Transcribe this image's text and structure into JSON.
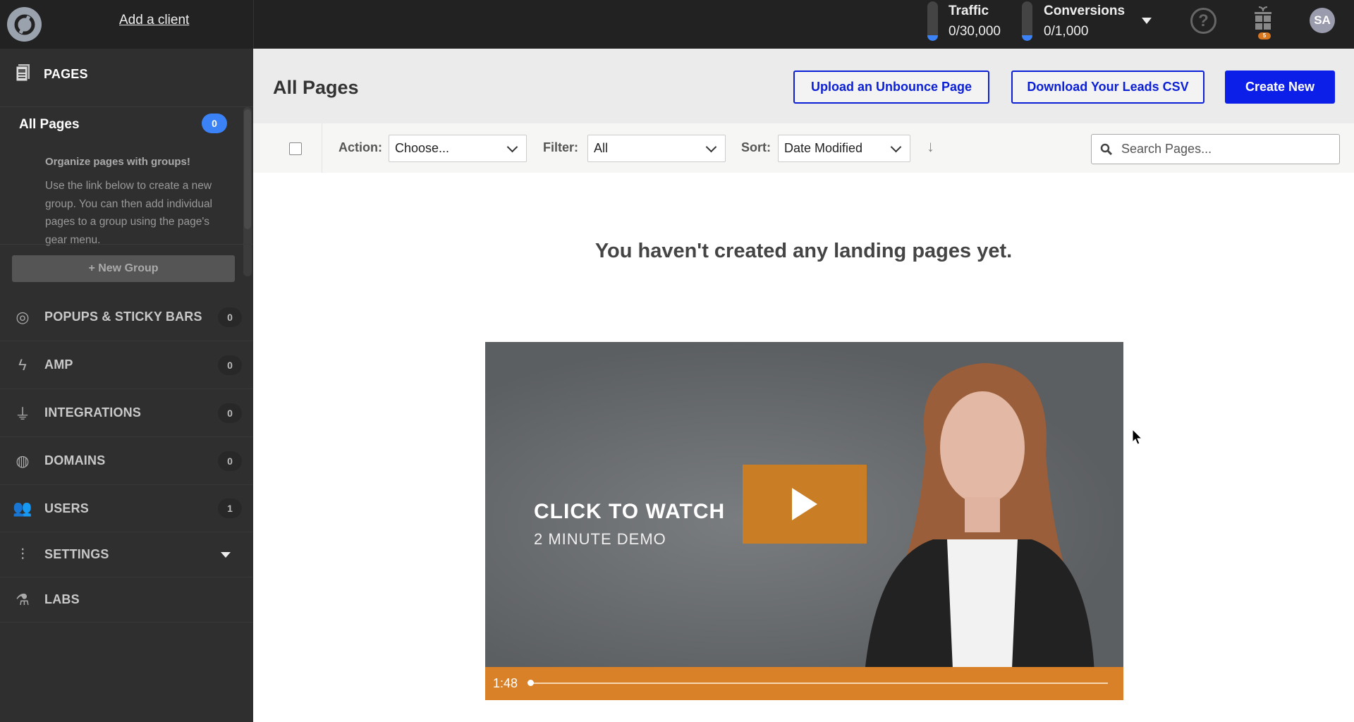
{
  "topbar": {
    "add_client": "Add a client",
    "traffic_label": "Traffic",
    "traffic_value": "0/30,000",
    "traffic_level": 0,
    "conversions_label": "Conversions",
    "conversions_value": "0/1,000",
    "conversions_level": 0,
    "help_glyph": "?",
    "gift_badge": "5",
    "avatar": "SA"
  },
  "sidebar": {
    "pages_label": "PAGES",
    "all_pages": "All Pages",
    "all_pages_count": "0",
    "org_title": "Organize pages with groups!",
    "org_text": "Use the link below to create a new group. You can then add individual pages to a group using the page's gear menu.",
    "new_group": "+ New Group",
    "items": [
      {
        "label": "POPUPS & STICKY BARS",
        "count": "0",
        "icon": "target-icon"
      },
      {
        "label": "AMP",
        "count": "0",
        "icon": "lightning-icon"
      },
      {
        "label": "INTEGRATIONS",
        "count": "0",
        "icon": "plug-icon"
      },
      {
        "label": "DOMAINS",
        "count": "0",
        "icon": "globe-icon"
      },
      {
        "label": "USERS",
        "count": "1",
        "icon": "users-icon"
      },
      {
        "label": "SETTINGS",
        "icon": "sliders-icon"
      },
      {
        "label": "LABS",
        "icon": "flask-icon"
      }
    ]
  },
  "header": {
    "title": "All Pages",
    "upload": "Upload an Unbounce Page",
    "download": "Download Your Leads CSV",
    "create": "Create New"
  },
  "toolbar": {
    "action_label": "Action:",
    "action_value": "Choose...",
    "filter_label": "Filter:",
    "filter_value": "All",
    "sort_label": "Sort:",
    "sort_value": "Date Modified",
    "search_placeholder": "Search Pages..."
  },
  "main": {
    "empty_message": "You haven't created any landing pages yet.",
    "video": {
      "line1": "CLICK TO WATCH",
      "line2": "2 MINUTE DEMO",
      "time": "1:48",
      "progress": 0
    }
  },
  "colors": {
    "accent": "#0b1fe8",
    "badge": "#3b82f6",
    "video_orange": "#d98128"
  }
}
